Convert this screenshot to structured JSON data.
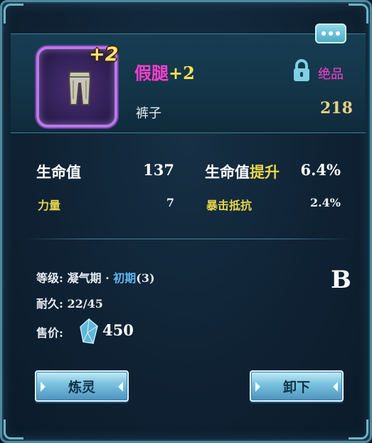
{
  "item": {
    "name": "假腿",
    "level": "+2",
    "badge": "+2",
    "type": "裤子",
    "quality": "绝品",
    "power": "218",
    "frame_color": "#b77ae8",
    "name_color": "#ff3fd0"
  },
  "stats": {
    "primary": [
      {
        "label": "生命值",
        "value": "137"
      },
      {
        "label_main": "生命值",
        "label_suffix": "提升",
        "value": "6.4%"
      }
    ],
    "secondary": [
      {
        "label": "力量",
        "value": "7"
      },
      {
        "label": "暴击抵抗",
        "value": "2.4%"
      }
    ]
  },
  "info": {
    "realm_label": "等级:",
    "realm_value": "凝气期",
    "realm_sep": "·",
    "realm_stage": "初期",
    "realm_num": "(3)",
    "durability_label": "耐久:",
    "durability_value": "22/45",
    "price_label": "售价:",
    "price_value": "450",
    "grade": "B"
  },
  "buttons": {
    "refine_label": "炼灵",
    "unequip_label": "卸下"
  },
  "icons": {
    "more": "more-dots-icon",
    "lock": "lock-icon",
    "currency": "crystal-icon",
    "item": "pants-icon"
  }
}
